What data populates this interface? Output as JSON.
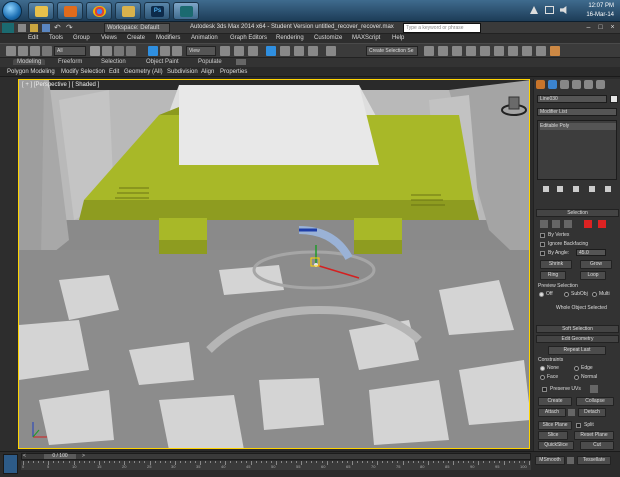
{
  "taskbar": {
    "apps": [
      "windows-explorer",
      "media-player",
      "chrome",
      "folder",
      "photoshop",
      "3ds-max"
    ],
    "photoshop_label": "Ps",
    "time": "12:07 PM",
    "date": "16-Mar-14"
  },
  "titlebar": {
    "workspace": "Workspace: Default",
    "title": "Autodesk 3ds Max  2014 x64 - Student Version    untitled_recover_recover.max",
    "search_placeholder": "Type a keyword or phrase"
  },
  "menu": [
    "Edit",
    "Tools",
    "Group",
    "Views",
    "Create",
    "Modifiers",
    "Animation",
    "Graph Editors",
    "Rendering",
    "Customize",
    "MAXScript",
    "Help"
  ],
  "toolbar": {
    "filter": "All",
    "reference": "View",
    "selection_set": "Create Selection Se"
  },
  "ribbon": {
    "tabs": [
      "Modeling",
      "Freeform",
      "Selection",
      "Object Paint",
      "Populate"
    ],
    "subtabs": [
      "Polygon Modeling",
      "Modify Selection",
      "Edit",
      "Geometry (All)",
      "Subdivision",
      "Align",
      "Properties"
    ]
  },
  "viewport": {
    "label": "[ + ] [Perspective ] [ Shaded ]"
  },
  "command_panel": {
    "object_name": "Line030",
    "modifier_list": "Modifier List",
    "stack_item": "Editable Poly",
    "selection_title": "Selection",
    "by_vertex": "By Vertex",
    "ignore_backfacing": "Ignore Backfacing",
    "by_angle": "By Angle:",
    "angle_value": "45.0",
    "shrink": "Shrink",
    "grow": "Grow",
    "ring": "Ring",
    "loop": "Loop",
    "preview_selection": "Preview Selection",
    "preview_options": [
      "Off",
      "SubObj",
      "Multi"
    ],
    "whole_object": "Whole Object Selected",
    "soft_selection": "Soft Selection",
    "edit_geometry": "Edit Geometry",
    "repeat_last": "Repeat Last",
    "constraints": "Constraints",
    "constraint_options": [
      "None",
      "Edge",
      "Face",
      "Normal"
    ],
    "preserve_uvs": "Preserve UVs",
    "create": "Create",
    "collapse": "Collapse",
    "attach": "Attach",
    "detach": "Detach",
    "slice_plane": "Slice Plane",
    "split": "Split",
    "slice": "Slice",
    "reset_plane": "Reset Plane",
    "quickslice": "QuickSlice",
    "cut": "Cut",
    "msmooth": "MSmooth",
    "tessellate": "Tessellate"
  },
  "timeline": {
    "frame": "0 / 100",
    "ticks": [
      "0",
      "5",
      "10",
      "15",
      "20",
      "25",
      "30",
      "35",
      "40",
      "45",
      "50",
      "55",
      "60",
      "65",
      "70",
      "75",
      "80",
      "85",
      "90",
      "95",
      "100"
    ]
  },
  "colors": {
    "selected_object": "#a8b828",
    "viewport_border": "#ffd400"
  }
}
